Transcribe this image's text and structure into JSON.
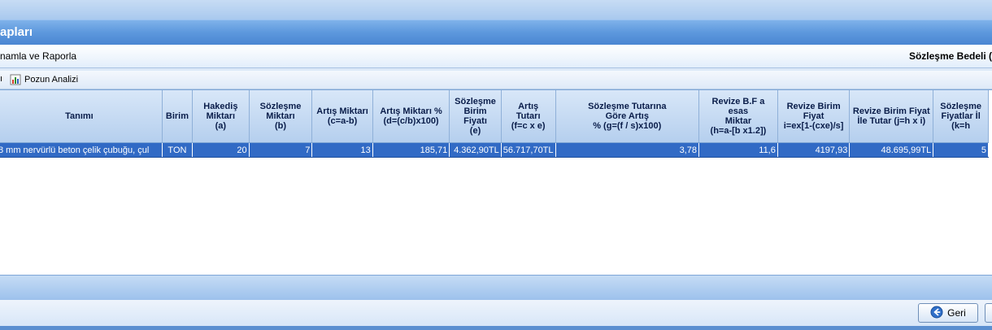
{
  "window": {
    "title_fragment": "apları"
  },
  "tabbar": {
    "left_fragment": "namla ve Raporla",
    "right_fragment": "Sözleşme Bedeli ("
  },
  "toolbar": {
    "left_fragment": "ı",
    "analysis_label": "Pozun Analizi",
    "analysis_icon": "chart-report-icon"
  },
  "table": {
    "columns": [
      "Tanımı",
      "Birim",
      "Hakediş\nMiktarı\n(a)",
      "Sözleşme\nMiktarı\n(b)",
      "Artış Miktarı\n(c=a-b)",
      "Artış Miktarı %\n(d=(c/b)x100)",
      "Sözleşme\nBirim\nFiyatı\n(e)",
      "Artış\nTutarı\n(f=c x e)",
      "Sözleşme Tutarına\nGöre Artış\n% (g=(f / s)x100)",
      "Revize B.F a esas\nMiktar\n(h=a-[b x1.2])",
      "Revize Birim\nFiyat\ni=ex[1-(cxe)/s]",
      "Revize Birim Fiyat\nİle Tutar (j=h x i)",
      "Sözleşme\nFiyatlar İl\n(k=h"
    ],
    "rows": [
      [
        "8 mm nervürlü beton çelik çubuğu, çul",
        "TON",
        "20",
        "7",
        "13",
        "185,71",
        "4.362,90TL",
        "56.717,70TL",
        "3,78",
        "11,6",
        "4197,93",
        "48.695,99TL",
        "5"
      ]
    ]
  },
  "footer": {
    "back_label": "Geri",
    "back_icon": "back-arrow-icon"
  },
  "colors": {
    "selection": "#316ac5",
    "title_bar": "#5d98dd",
    "header_bg": "#c7dcf4"
  }
}
